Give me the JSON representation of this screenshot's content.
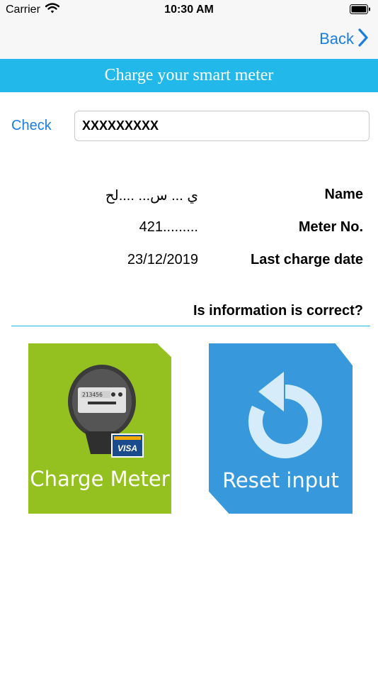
{
  "status_bar": {
    "carrier": "Carrier",
    "time": "10:30 AM"
  },
  "nav": {
    "back_label": "Back"
  },
  "header": {
    "title": "Charge your smart meter",
    "color": "#22b8ea"
  },
  "search": {
    "check_label": "Check",
    "meter_value": "XXXXXXXXX"
  },
  "info": {
    "name_label": "Name",
    "name_value": "ي ... س... ....لح",
    "meter_label": "Meter No.",
    "meter_value": "421.........",
    "date_label": "Last charge date",
    "date_value": "23/12/2019"
  },
  "question": "Is information is correct?",
  "actions": {
    "charge_label": "Charge Meter",
    "charge_color": "#94c11f",
    "charge_icon": "electric-meter-visa-icon",
    "meter_display": "213456",
    "card_brand": "VISA",
    "reset_label": "Reset input",
    "reset_color": "#3798dc",
    "reset_icon": "reset-arrow-icon"
  },
  "colors": {
    "accent": "#1a7ee0",
    "divider": "#22b8ea"
  }
}
